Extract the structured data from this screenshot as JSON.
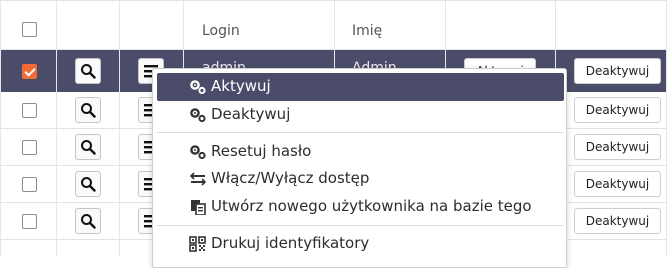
{
  "table": {
    "headers": {
      "login": "Login",
      "first_name": "Imię"
    },
    "rows": [
      {
        "login": "admin",
        "first_name": "Admin",
        "selected": true,
        "activate_label": "Aktywuj",
        "deactivate_label": "Deaktywuj"
      },
      {
        "deactivate_label": "Deaktywuj"
      },
      {
        "deactivate_label": "Deaktywuj"
      },
      {
        "deactivate_label": "Deaktywuj"
      },
      {
        "deactivate_label": "Deaktywuj"
      }
    ]
  },
  "dropdown": {
    "items": [
      {
        "label": "Aktywuj",
        "icon": "gears-icon",
        "active": true
      },
      {
        "label": "Deaktywuj",
        "icon": "gears-icon"
      },
      {
        "label": "Resetuj hasło",
        "icon": "gears-icon"
      },
      {
        "label": "Włącz/Wyłącz dostęp",
        "icon": "toggle-arrows-icon"
      },
      {
        "label": "Utwórz nowego użytkownika na bazie tego",
        "icon": "copy-icon"
      },
      {
        "label": "Drukuj identyfikatory",
        "icon": "qrcode-icon"
      }
    ]
  },
  "colors": {
    "selected_row": "#4b4c69",
    "checkbox_checked": "#f26b36"
  }
}
